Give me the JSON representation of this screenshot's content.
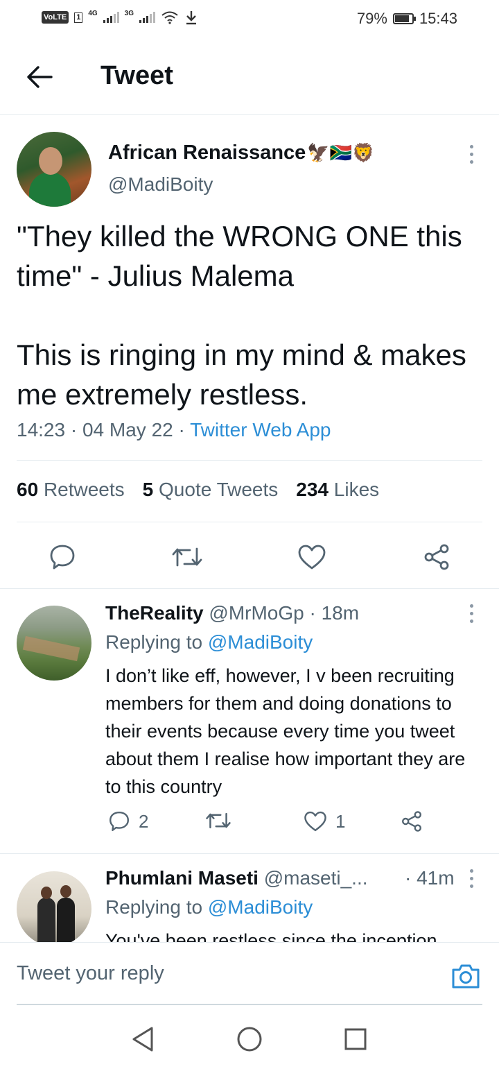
{
  "status_bar": {
    "volte": "VoLTE",
    "sim": "1",
    "net1": "4G",
    "net2": "3G",
    "battery": "79%",
    "time": "15:43"
  },
  "header": {
    "title": "Tweet"
  },
  "tweet": {
    "author_name": "African Renaissance",
    "author_emojis": "🦅🇿🇦🦁",
    "author_handle": "@MadiBoity",
    "text": "\"They killed the WRONG ONE this time\" - Julius Malema\n\nThis is ringing in my mind & makes me extremely restless.",
    "time": "14:23",
    "date": "04 May 22",
    "source": "Twitter Web App",
    "stats": {
      "retweets_count": "60",
      "retweets_label": "Retweets",
      "quotes_count": "5",
      "quotes_label": "Quote Tweets",
      "likes_count": "234",
      "likes_label": "Likes"
    }
  },
  "replies": [
    {
      "name": "TheReality",
      "handle": "@MrMoGp",
      "age": "· 18m",
      "replying_label": "Replying to",
      "replying_handle": "@MadiBoity",
      "text": "I don’t like eff, however, I v been recruiting members for them and doing donations to their events because every time you tweet about them I realise how important they are to this country",
      "reply_count": "2",
      "like_count": "1"
    },
    {
      "name": "Phumlani Maseti",
      "handle": "@maseti_...",
      "age": "· 41m",
      "replying_label": "Replying to",
      "replying_handle": "@MadiBoity",
      "text": "You've been restless since the inception"
    }
  ],
  "compose": {
    "placeholder": "Tweet your reply"
  },
  "icons": {
    "back": "arrow-left-icon",
    "more": "more-vertical-icon",
    "reply": "comment-icon",
    "retweet": "retweet-icon",
    "like": "heart-icon",
    "share": "share-icon",
    "camera": "camera-icon",
    "nav_back": "triangle-back-icon",
    "nav_home": "circle-home-icon",
    "nav_recents": "square-recents-icon"
  },
  "colors": {
    "accent": "#2c8ed6",
    "muted": "#536471",
    "text": "#0f1419",
    "divider": "#e6ecf0"
  }
}
